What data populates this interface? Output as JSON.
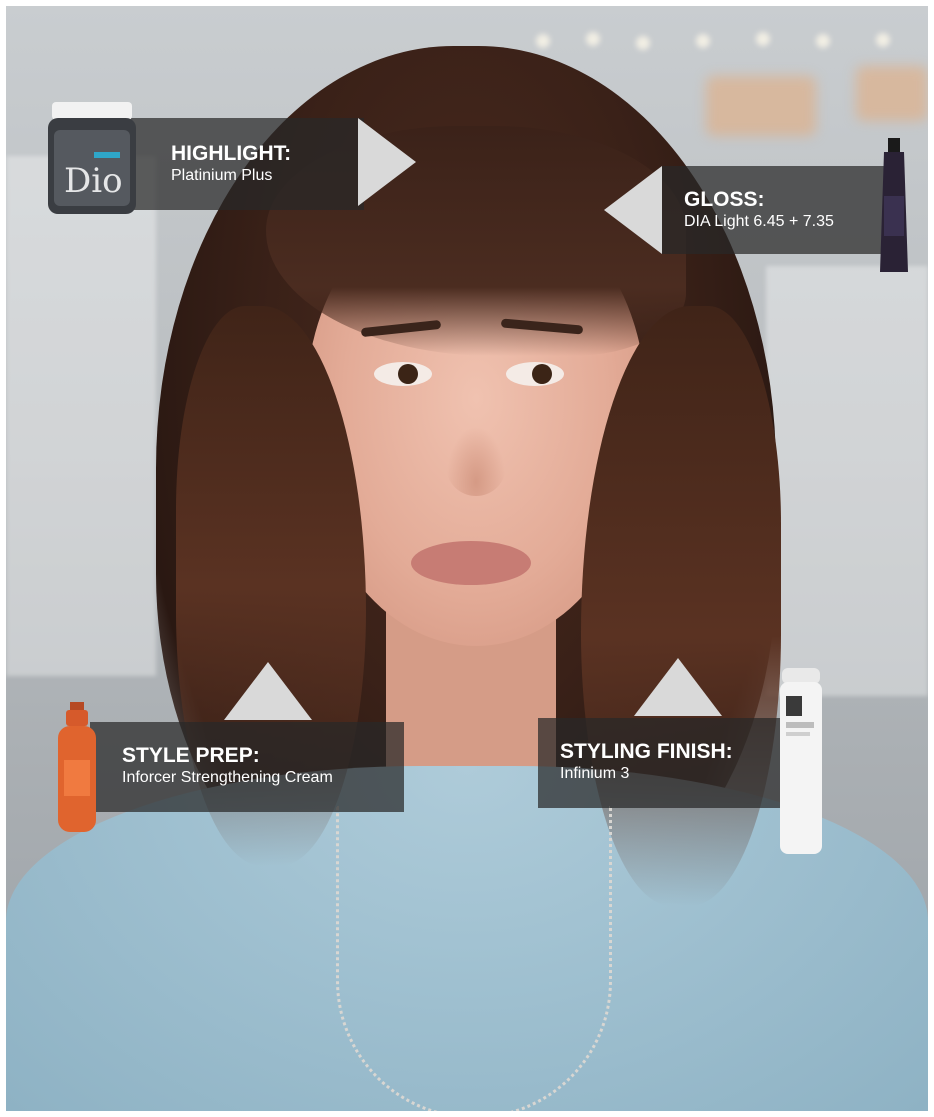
{
  "callouts": {
    "highlight": {
      "title": "HIGHLIGHT:",
      "product": "Platinium Plus"
    },
    "gloss": {
      "title": "GLOSS:",
      "product": "DIA Light 6.45 + 7.35"
    },
    "style_prep": {
      "title": "STYLE PREP:",
      "product": "Inforcer Strengthening Cream"
    },
    "styling_finish": {
      "title": "STYLING FINISH:",
      "product": "Infinium 3"
    }
  },
  "colors": {
    "label_bg": "#282828",
    "arrow": "#d9d9d9",
    "text": "#ffffff"
  }
}
